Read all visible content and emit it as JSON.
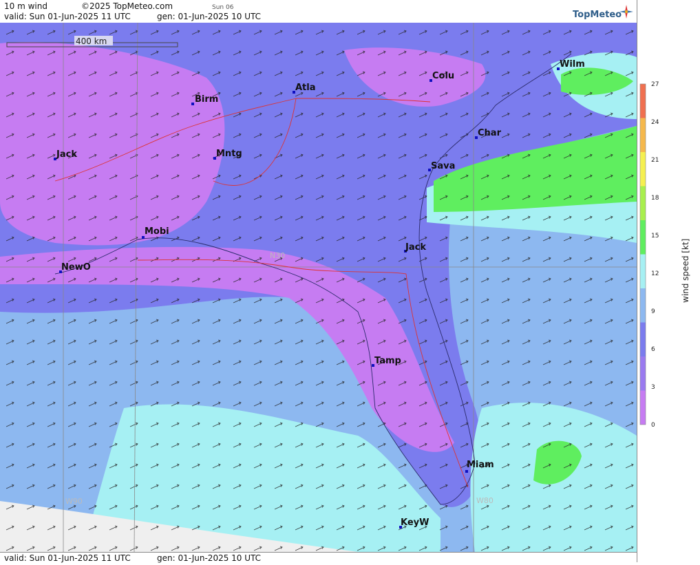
{
  "header": {
    "field": "10 m wind",
    "copyright": "©2025 TopMeteo.com",
    "day_marker": "Sun 06",
    "valid": "valid:  Sun  01-Jun-2025  11 UTC",
    "gen": "gen: 01-Jun-2025 10 UTC",
    "logo": "TopMeteo"
  },
  "footer": {
    "valid": "valid:  Sun  01-Jun-2025  11 UTC",
    "gen": "gen: 01-Jun-2025 10 UTC"
  },
  "map": {
    "scale": "400 km",
    "grid_labels": {
      "lat": "N30",
      "lon_west": "W90",
      "lon_east": "W80"
    },
    "cities": [
      "Birm",
      "Atla",
      "Colu",
      "Wilm",
      "Char",
      "Sava",
      "Jack",
      "Mntg",
      "Mobi",
      "NewO",
      "Jack",
      "Tamp",
      "Miam",
      "KeyW"
    ]
  },
  "legend": {
    "title": "wind speed [kt]",
    "ticks": [
      "27",
      "24",
      "21",
      "18",
      "15",
      "12",
      "9",
      "6",
      "3",
      "0"
    ],
    "colors": [
      "#c67cf2",
      "#9a7af0",
      "#7b7cee",
      "#8db8f0",
      "#a6f0f3",
      "#5fee5f",
      "#a8ef4d",
      "#f5f050",
      "#f5b84c",
      "#f07050"
    ]
  }
}
